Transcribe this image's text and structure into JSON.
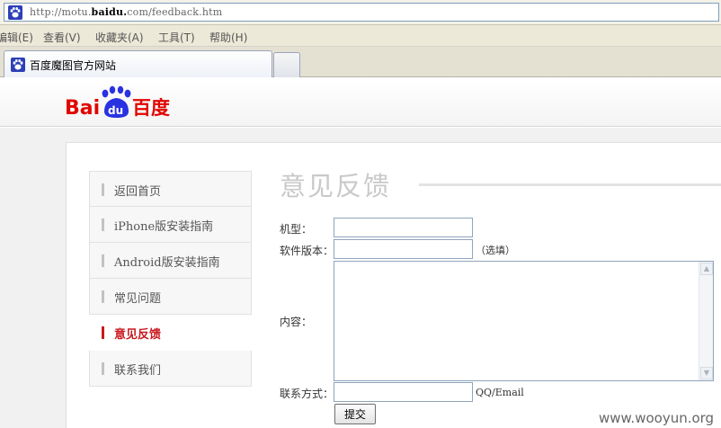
{
  "browser": {
    "url_prefix": "http://motu.",
    "url_domain": "baidu.",
    "url_suffix": "com/feedback.htm",
    "menu": [
      "编辑(E)",
      "查看(V)",
      "收藏夹(A)",
      "工具(T)",
      "帮助(H)"
    ],
    "tab_title": "百度魔图官方网站"
  },
  "header": {
    "logo_text_bai": "Bai",
    "logo_text_du": "du",
    "logo_text_cn": "百度"
  },
  "sidebar": {
    "items": [
      {
        "label": "返回首页",
        "active": false
      },
      {
        "label": "iPhone版安装指南",
        "active": false
      },
      {
        "label": "Android版安装指南",
        "active": false
      },
      {
        "label": "常见问题",
        "active": false
      },
      {
        "label": "意见反馈",
        "active": true
      },
      {
        "label": "联系我们",
        "active": false
      }
    ]
  },
  "main": {
    "title": "意见反馈",
    "form": {
      "model_label": "机型：",
      "model_value": "",
      "version_label": "软件版本：",
      "version_value": "",
      "version_hint": "（选填）",
      "content_label": "内容：",
      "content_value": "",
      "contact_label": "联系方式：",
      "contact_value": "",
      "contact_hint": "QQ/Email",
      "submit_label": "提交"
    }
  },
  "watermark": "www.wooyun.org",
  "colors": {
    "baidu_red": "#c8181e",
    "baidu_blue": "#2932e1"
  }
}
